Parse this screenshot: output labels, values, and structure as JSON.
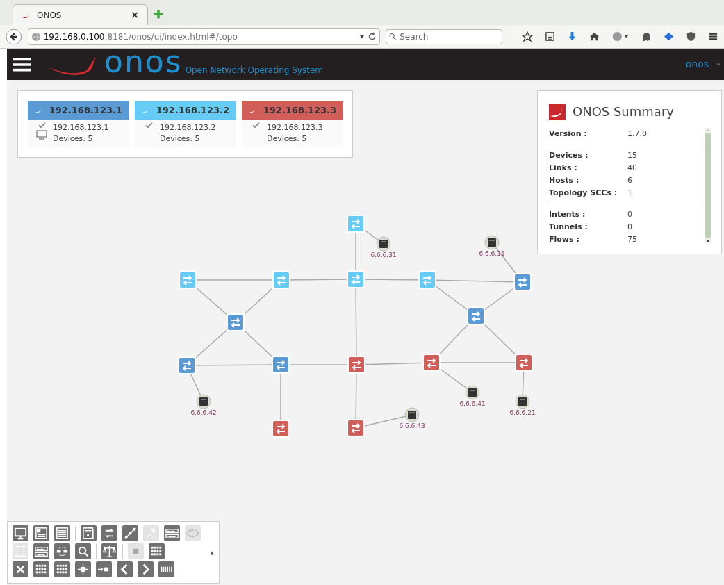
{
  "browser": {
    "tab": {
      "title": "ONOS",
      "close": "×"
    },
    "url": {
      "host": "192.168.0.100",
      "rest": ":8181/onos/ui/index.html#/topo"
    },
    "search": {
      "placeholder": "Search"
    }
  },
  "header": {
    "logo_text": "onos",
    "subtitle": "Open Network Operating System",
    "user": "onos"
  },
  "clusters": [
    {
      "title": "192.168.123.1",
      "color": "#5b9bd5",
      "ip": "192.168.123.1",
      "devices": "Devices: 5",
      "current": true
    },
    {
      "title": "192.168.123.2",
      "color": "#66ccf5",
      "ip": "192.168.123.2",
      "devices": "Devices: 5",
      "current": false
    },
    {
      "title": "192.168.123.3",
      "color": "#d05f5a",
      "ip": "192.168.123.3",
      "devices": "Devices: 5",
      "current": false
    }
  ],
  "summary": {
    "title": "ONOS Summary",
    "groups": [
      [
        {
          "label": "Version :",
          "value": "1.7.0"
        }
      ],
      [
        {
          "label": "Devices :",
          "value": "15"
        },
        {
          "label": "Links :",
          "value": "40"
        },
        {
          "label": "Hosts :",
          "value": "6"
        },
        {
          "label": "Topology SCCs :",
          "value": "1"
        }
      ],
      [
        {
          "label": "Intents :",
          "value": "0"
        },
        {
          "label": "Tunnels :",
          "value": "0"
        },
        {
          "label": "Flows :",
          "value": "75"
        }
      ]
    ]
  },
  "topology": {
    "switches": [
      {
        "color": "#66ccf5"
      },
      {
        "color": "#66ccf5"
      },
      {
        "color": "#66ccf5"
      },
      {
        "color": "#66ccf5"
      },
      {
        "color": "#66ccf5"
      },
      {
        "color": "#5b9bd5"
      },
      {
        "color": "#5b9bd5"
      },
      {
        "color": "#5b9bd5"
      },
      {
        "color": "#5b9bd5"
      },
      {
        "color": "#5b9bd5"
      },
      {
        "color": "#d05f5a"
      },
      {
        "color": "#d05f5a"
      },
      {
        "color": "#d05f5a"
      },
      {
        "color": "#d05f5a"
      },
      {
        "color": "#d05f5a"
      }
    ],
    "hosts": [
      {
        "label": "6.6.6.31"
      },
      {
        "label": "6.6.6.11"
      },
      {
        "label": "6.6.6.42"
      },
      {
        "label": "6.6.6.41"
      },
      {
        "label": "6.6.6.21"
      },
      {
        "label": "6.6.6.43"
      }
    ]
  },
  "toolbar": {
    "rows": [
      [
        {
          "kind": "monitor",
          "disabled": false
        },
        {
          "kind": "panel",
          "disabled": false
        },
        {
          "kind": "list",
          "disabled": false
        },
        {
          "kind": "separator"
        },
        {
          "kind": "device",
          "disabled": false
        },
        {
          "kind": "switch",
          "disabled": false
        },
        {
          "kind": "path",
          "disabled": false
        },
        {
          "kind": "cross-map",
          "disabled": true
        },
        {
          "kind": "waves",
          "disabled": false
        },
        {
          "kind": "ring",
          "disabled": true
        }
      ],
      [
        {
          "kind": "film",
          "disabled": true
        },
        {
          "kind": "waves",
          "disabled": false
        },
        {
          "kind": "cycle",
          "disabled": false
        },
        {
          "kind": "zoom",
          "disabled": false
        },
        {
          "kind": "separator"
        },
        {
          "kind": "scales",
          "disabled": false
        },
        {
          "kind": "separator"
        },
        {
          "kind": "square",
          "disabled": true
        },
        {
          "kind": "grid",
          "disabled": false
        }
      ],
      [
        {
          "kind": "close",
          "disabled": false
        },
        {
          "kind": "grid",
          "disabled": false
        },
        {
          "kind": "grid",
          "disabled": false
        },
        {
          "kind": "node",
          "disabled": false
        },
        {
          "kind": "arrow-block",
          "disabled": false
        },
        {
          "kind": "prev",
          "disabled": false
        },
        {
          "kind": "next",
          "disabled": false
        },
        {
          "kind": "barcode",
          "disabled": false
        }
      ]
    ]
  }
}
